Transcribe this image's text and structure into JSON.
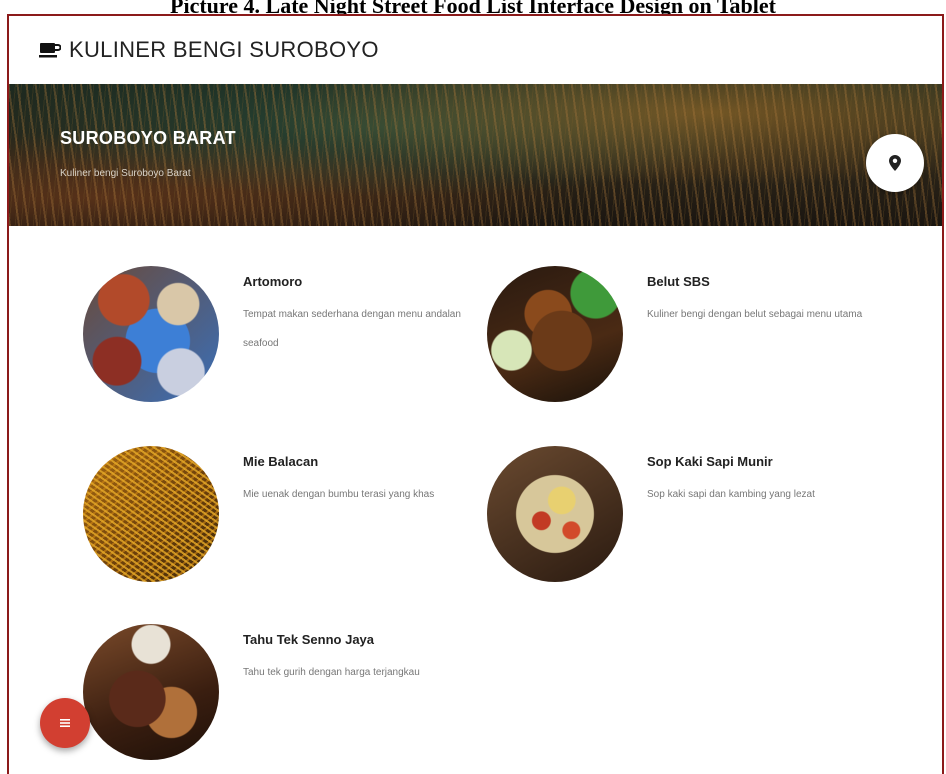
{
  "caption": "Picture 4. Late Night Street Food List Interface Design on Tablet",
  "app": {
    "title": "KULINER BENGI SUROBOYO",
    "icon": "coffee-cup-icon"
  },
  "hero": {
    "title": "SUROBOYO BARAT",
    "subtitle": "Kuliner bengi Suroboyo Barat",
    "location_icon": "map-pin-icon"
  },
  "items": [
    {
      "name": "Artomoro",
      "desc": "Tempat makan sederhana dengan menu andalan seafood",
      "image": "seafood-photo"
    },
    {
      "name": "Belut SBS",
      "desc": "Kuliner bengi dengan belut sebagai menu utama",
      "image": "eel-dish-photo"
    },
    {
      "name": "Mie Balacan",
      "desc": "Mie uenak dengan bumbu terasi yang khas",
      "image": "noodles-photo"
    },
    {
      "name": "Sop Kaki Sapi Munir",
      "desc": "Sop kaki sapi dan kambing yang lezat",
      "image": "soup-photo"
    },
    {
      "name": "Tahu Tek Senno Jaya",
      "desc": "Tahu tek gurih dengan harga terjangkau",
      "image": "tofu-dish-photo"
    }
  ],
  "fab": {
    "icon": "menu-icon"
  },
  "colors": {
    "fab": "#d23f31",
    "frame_border": "#8b1a1a"
  }
}
